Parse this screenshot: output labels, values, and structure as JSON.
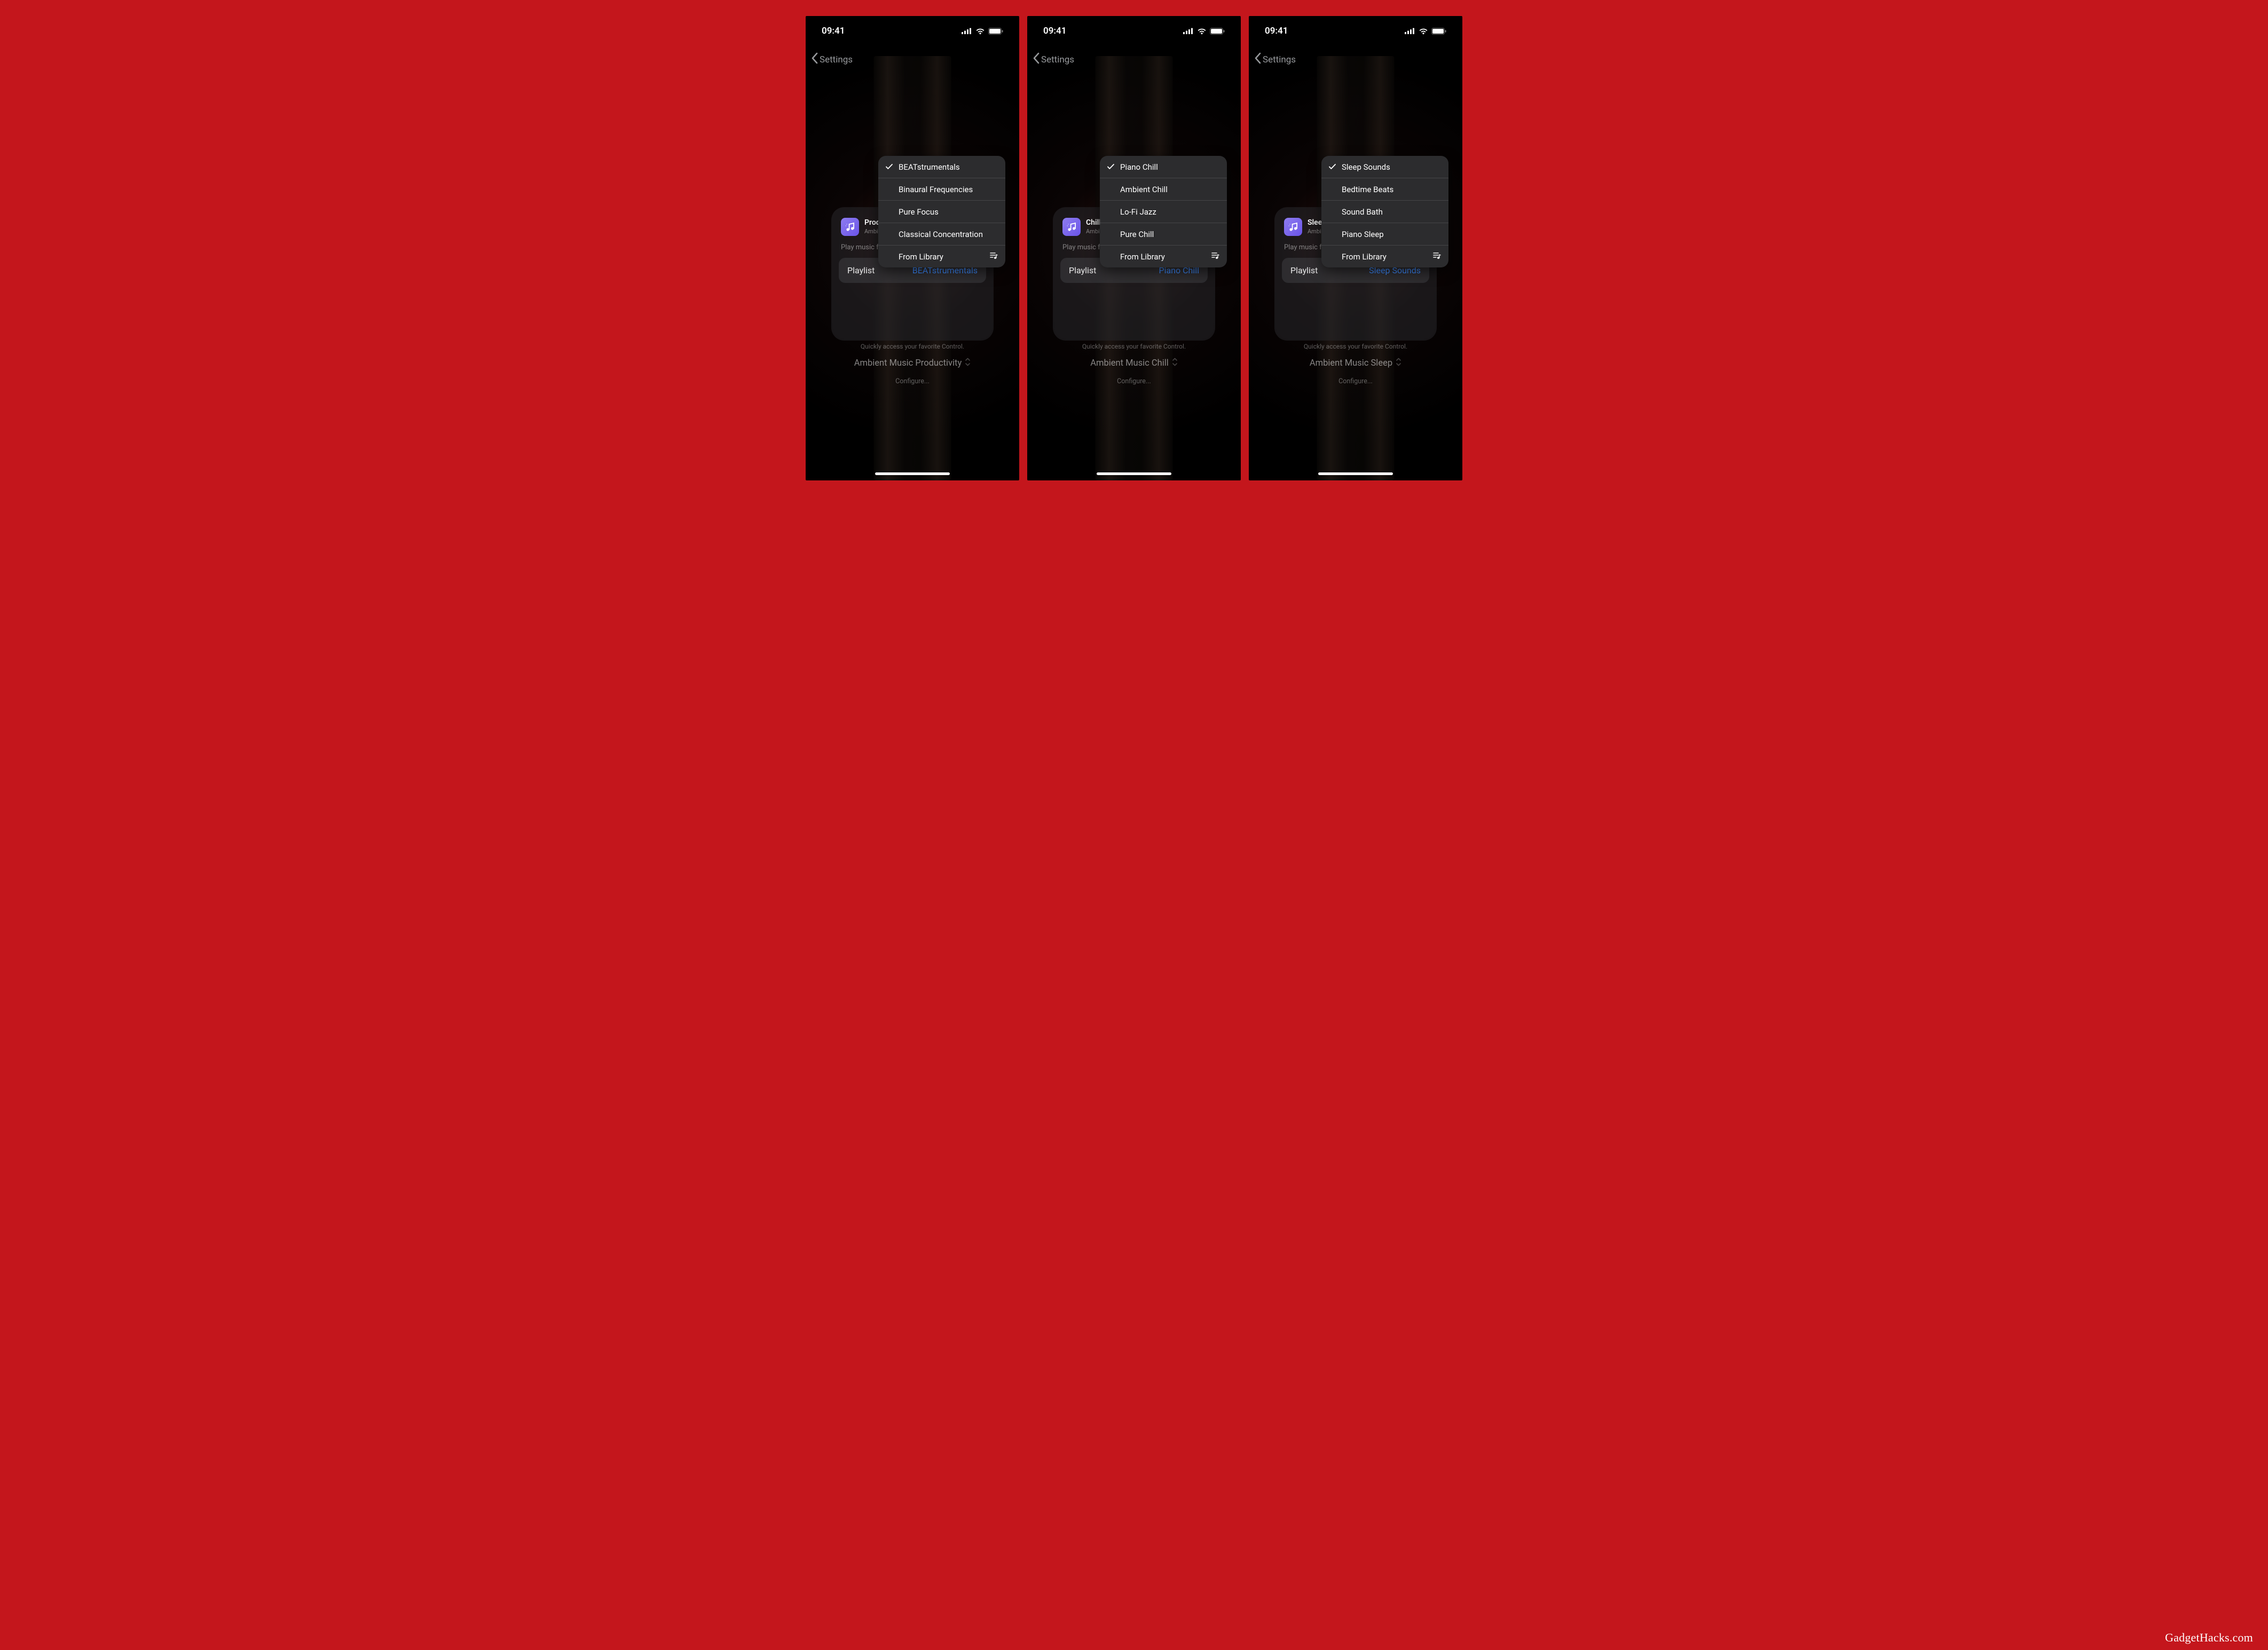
{
  "watermark": "GadgetHacks.com",
  "common": {
    "time": "09:41",
    "back_label": "Settings",
    "hint": "Quickly access your favorite Control.",
    "configure": "Configure...",
    "playlist_label": "Playlist",
    "from_library": "From Library",
    "app_sub_truncated": "Ambien",
    "play_desc_truncated": "Play music for"
  },
  "screens": [
    {
      "title_truncated": "Produc",
      "playlist_value": "BEATstrumentals",
      "mode_line": "Ambient Music Productivity",
      "options": [
        "BEATstrumentals",
        "Binaural Frequencies",
        "Pure Focus",
        "Classical Concentration"
      ],
      "selected_index": 0
    },
    {
      "title_truncated": "Chill",
      "playlist_value": "Piano Chill",
      "mode_line": "Ambient Music Chill",
      "options": [
        "Piano Chill",
        "Ambient Chill",
        "Lo-Fi Jazz",
        "Pure Chill"
      ],
      "selected_index": 0
    },
    {
      "title_truncated": "Sleep",
      "playlist_value": "Sleep Sounds",
      "mode_line": "Ambient Music Sleep",
      "options": [
        "Sleep Sounds",
        "Bedtime Beats",
        "Sound Bath",
        "Piano Sleep"
      ],
      "selected_index": 0
    }
  ]
}
